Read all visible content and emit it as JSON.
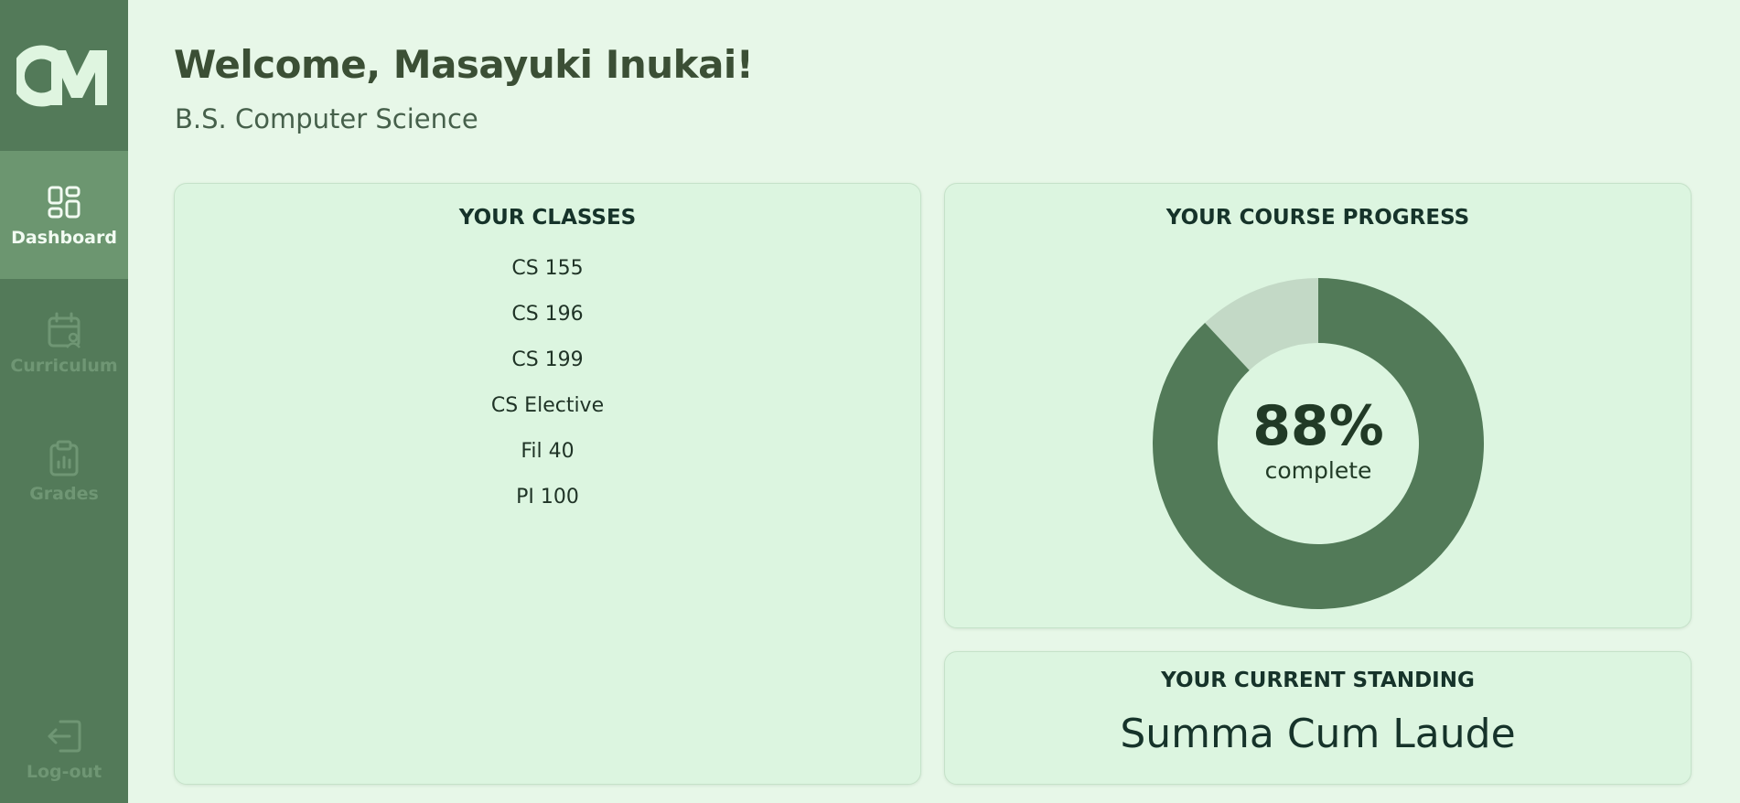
{
  "sidebar": {
    "logo_text": "CM",
    "items": [
      {
        "label": "Dashboard",
        "icon": "dashboard-grid-icon",
        "active": true
      },
      {
        "label": "Curriculum",
        "icon": "calendar-user-icon",
        "active": false
      },
      {
        "label": "Grades",
        "icon": "clipboard-chart-icon",
        "active": false
      }
    ],
    "logout": {
      "label": "Log-out",
      "icon": "logout-icon"
    }
  },
  "header": {
    "title": "Welcome, Masayuki Inukai!",
    "subtitle": "B.S. Computer Science"
  },
  "classes": {
    "title": "YOUR CLASSES",
    "items": [
      "CS 155",
      "CS 196",
      "CS 199",
      "CS Elective",
      "Fil 40",
      "PI 100"
    ]
  },
  "progress": {
    "title": "YOUR COURSE PROGRESS",
    "percent_text": "88%",
    "percent_value": 0.88,
    "caption": "complete"
  },
  "standing": {
    "title": "YOUR CURRENT STANDING",
    "value": "Summa Cum Laude"
  },
  "colors": {
    "sidebar": "#537a59",
    "sidebar_active": "#6c9670",
    "background": "#e7f7e8",
    "card": "#dcf5e0",
    "donut_filled": "#527a58",
    "donut_remaining": "#c3d9c6"
  }
}
